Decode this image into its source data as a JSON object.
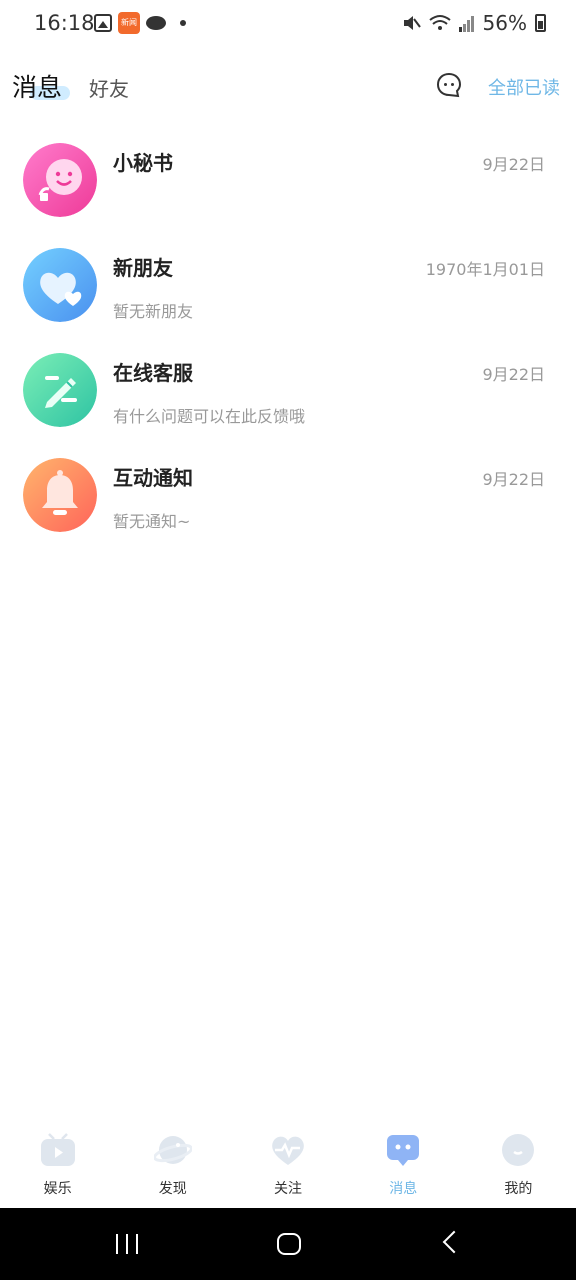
{
  "status_bar": {
    "time": "16:18",
    "battery": "56%",
    "app_badge": "新闻"
  },
  "header": {
    "tab_messages": "消息",
    "tab_friends": "好友",
    "mark_all_read": "全部已读"
  },
  "messages": [
    {
      "title": "小秘书",
      "subtitle": "",
      "date": "9月22日",
      "icon": "smile-face-icon",
      "gradient": [
        "#ff78c8",
        "#f03e9c"
      ]
    },
    {
      "title": "新朋友",
      "subtitle": "暂无新朋友",
      "date": "1970年1月01日",
      "icon": "heart-icon",
      "gradient": [
        "#6ec8ff",
        "#4a9af0"
      ]
    },
    {
      "title": "在线客服",
      "subtitle": "有什么问题可以在此反馈哦",
      "date": "9月22日",
      "icon": "edit-icon",
      "gradient": [
        "#6fe8b0",
        "#31c7a5"
      ]
    },
    {
      "title": "互动通知",
      "subtitle": "暂无通知~",
      "date": "9月22日",
      "icon": "bell-icon",
      "gradient": [
        "#ffab6a",
        "#ff6a5c"
      ]
    }
  ],
  "bottom_nav": [
    {
      "label": "娱乐",
      "icon": "tv-play-icon"
    },
    {
      "label": "发现",
      "icon": "planet-icon"
    },
    {
      "label": "关注",
      "icon": "heartbeat-icon"
    },
    {
      "label": "消息",
      "icon": "chat-bubble-icon",
      "active": true
    },
    {
      "label": "我的",
      "icon": "profile-face-icon"
    }
  ],
  "colors": {
    "accent": "#6fb7e6",
    "nav_inactive_icon": "#dfe6ee",
    "nav_active_icon": "#8fb4f5"
  }
}
